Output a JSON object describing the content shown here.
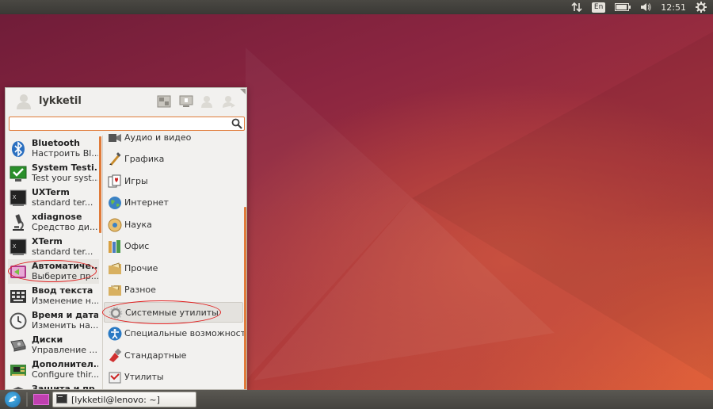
{
  "top_panel": {
    "language": "En",
    "time": "12:51",
    "icons": [
      "network-arrows-icon",
      "battery-icon",
      "volume-icon",
      "gear-icon"
    ]
  },
  "menu": {
    "user_name": "lykketil",
    "search_value": "",
    "search_placeholder": "",
    "apps": [
      {
        "title": "Bluetooth",
        "subtitle": "Настроить Bl...",
        "icon": "bluetooth-icon"
      },
      {
        "title": "System Testi...",
        "subtitle": "Test your syst...",
        "icon": "checkmark-icon"
      },
      {
        "title": "UXTerm",
        "subtitle": "standard ter...",
        "icon": "terminal-icon"
      },
      {
        "title": "xdiagnose",
        "subtitle": "Средство ди...",
        "icon": "microscope-icon"
      },
      {
        "title": "XTerm",
        "subtitle": "standard ter...",
        "icon": "terminal-icon"
      },
      {
        "title": "Автоматиче...",
        "subtitle": "Выберите пр...",
        "icon": "default-apps-icon"
      },
      {
        "title": "Ввод текста",
        "subtitle": "Изменение н...",
        "icon": "keyboard-icon"
      },
      {
        "title": "Время и дата",
        "subtitle": "Изменить на...",
        "icon": "clock-icon"
      },
      {
        "title": "Диски",
        "subtitle": "Управление ...",
        "icon": "disk-icon"
      },
      {
        "title": "Дополнител...",
        "subtitle": "Configure thir...",
        "icon": "chip-icon"
      },
      {
        "title": "Защита и пр...",
        "subtitle": "",
        "icon": "shield-icon"
      }
    ],
    "categories": [
      {
        "label": "Аудио и видео",
        "icon": "multimedia-icon"
      },
      {
        "label": "Графика",
        "icon": "graphics-icon"
      },
      {
        "label": "Игры",
        "icon": "cards-icon"
      },
      {
        "label": "Интернет",
        "icon": "globe-icon"
      },
      {
        "label": "Наука",
        "icon": "science-icon"
      },
      {
        "label": "Офис",
        "icon": "office-icon"
      },
      {
        "label": "Прочие",
        "icon": "folder-icon"
      },
      {
        "label": "Разное",
        "icon": "folder-icon"
      },
      {
        "label": "Системные утилиты",
        "icon": "system-gear-icon"
      },
      {
        "label": "Специальные возможности",
        "icon": "accessibility-icon"
      },
      {
        "label": "Стандартные",
        "icon": "accessories-icon"
      },
      {
        "label": "Утилиты",
        "icon": "utilities-icon"
      }
    ]
  },
  "taskbar": {
    "window_label": "[lykketil@lenovo: ~]"
  },
  "colors": {
    "accent": "#e07b3a",
    "annotation": "#e02020",
    "panel": "#3c3b37"
  }
}
